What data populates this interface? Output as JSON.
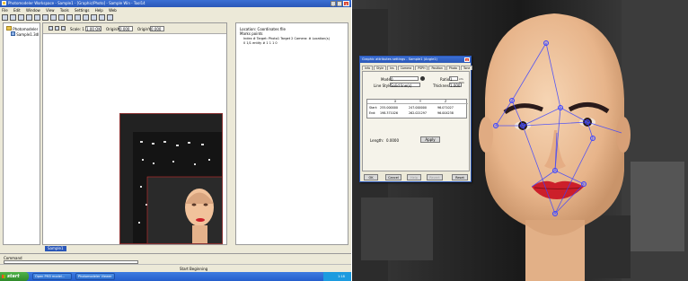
{
  "window": {
    "title": "Photomodeler Workspace - Sample1 - [Graphic/Photo] - Sample Win - Tool14",
    "menu": [
      "File",
      "Edit",
      "Window",
      "View",
      "Tools",
      "Settings",
      "Help",
      "Web"
    ],
    "min": "_",
    "max": "□",
    "close": "x"
  },
  "tree": {
    "root": "Photomodeler",
    "child": "Sample1.3dl"
  },
  "viewer_toolbar": {
    "scale_label": "Scale: 1",
    "scale_value": "1.00 OK",
    "origin_x_label": "OriginX",
    "origin_x_value": "0.000",
    "origin_y_label": "OriginY",
    "origin_y_value": "0.000"
  },
  "info_panel": {
    "header": "Location: Coordinates file",
    "subheader": "Marks points",
    "lines": [
      "Index #   Target: Photo1   Target 2  Camera: # Location(s)",
      "0  1/1        entity  # 1          1     1  0"
    ]
  },
  "tabs": {
    "active": "Sample1"
  },
  "bottom_bar": {
    "command_label": "Command",
    "status": "Start Beginning"
  },
  "taskbar": {
    "start": "start",
    "items": [
      "Open PM3 model...",
      "Photomodeler Viewer"
    ],
    "clock": "1:18"
  },
  "dialog": {
    "title": "Graphic attributes settings - Sample1 (Angle1)",
    "close": "x",
    "tabs": [
      "Info",
      "Style",
      "Ins",
      "Camera",
      "PSPH",
      "Position",
      "Photo",
      "Tone"
    ],
    "mode_label": "Mode:",
    "mode_value": "0",
    "line_label": "Line Style:",
    "line_value": "Solid line(s)",
    "ratio_label": "Ratio:",
    "ratio_value": "1",
    "ratio_unit": "cm mm",
    "thickness_label": "Thickness:",
    "thickness_value": "1.000",
    "table_headers": [
      "",
      "X",
      "Y",
      "Z"
    ],
    "table_rows": [
      [
        "Start:",
        "255.000000",
        "247.000000",
        "96.071027"
      ],
      [
        "End:",
        "198.371026",
        "262.021297",
        "96.004238"
      ]
    ],
    "length_label": "Length:",
    "length_value": "0.0000",
    "apply_button": "Apply",
    "ok_button": "OK",
    "cancel_button": "Cancel",
    "help_button": "Help",
    "revert_button": "Revert",
    "reset_button": "Reset"
  },
  "colors": {
    "xp_blue": "#2a57b8",
    "dialog_bg": "#ece9d8",
    "lips": "#cc1f2a",
    "measure_lines": "#3b43ff"
  }
}
